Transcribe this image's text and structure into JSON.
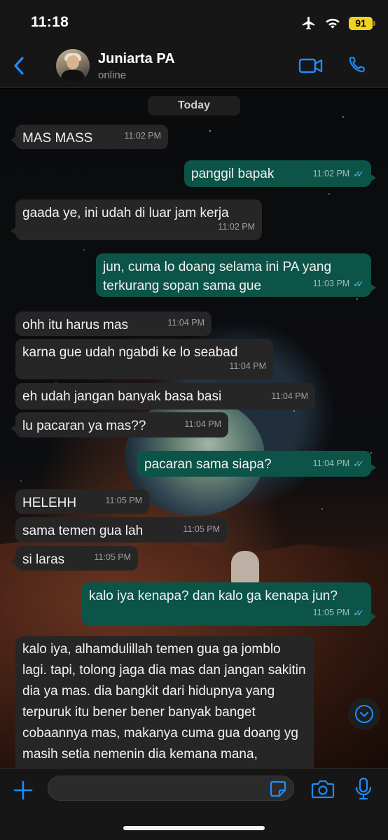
{
  "status_bar": {
    "time": "11:18",
    "battery": "91"
  },
  "header": {
    "contact_name": "Juniarta PA",
    "contact_status": "online",
    "back_icon": "chevron-left-icon",
    "video_icon": "video-camera-icon",
    "call_icon": "phone-icon"
  },
  "chat": {
    "date_label": "Today",
    "messages": [
      {
        "direction": "in",
        "text": "MAS MASS",
        "time": "11:02 PM"
      },
      {
        "direction": "out",
        "text": "panggil bapak",
        "time": "11:02 PM",
        "read": true
      },
      {
        "direction": "in",
        "text": "gaada ye, ini udah di luar jam kerja",
        "time": "11:02 PM"
      },
      {
        "direction": "out",
        "text": "jun, cuma lo doang selama ini PA yang terkurang sopan sama gue",
        "time": "11:03 PM",
        "read": true
      },
      {
        "direction": "in",
        "text": "ohh itu harus mas",
        "time": "11:04 PM"
      },
      {
        "direction": "in",
        "text": "karna gue udah ngabdi ke lo seabad",
        "time": "11:04 PM"
      },
      {
        "direction": "in",
        "text": "eh udah jangan banyak basa basi",
        "time": "11:04 PM"
      },
      {
        "direction": "in",
        "text": "lu pacaran ya mas??",
        "time": "11:04 PM"
      },
      {
        "direction": "out",
        "text": "pacaran sama siapa?",
        "time": "11:04 PM",
        "read": true
      },
      {
        "direction": "in",
        "text": "HELEHH",
        "time": "11:05 PM"
      },
      {
        "direction": "in",
        "text": "sama temen gua lah",
        "time": "11:05 PM"
      },
      {
        "direction": "in",
        "text": "si laras",
        "time": "11:05 PM"
      },
      {
        "direction": "out",
        "text": "kalo iya kenapa? dan kalo ga kenapa jun?",
        "time": "11:05 PM",
        "read": true
      },
      {
        "direction": "in",
        "text": "kalo iya, alhamdulillah temen gua ga jomblo lagi. tapi, tolong jaga dia mas dan jangan sakitin dia ya mas. dia bangkit dari hidupnya yang terpuruk itu bener bener banyak banget cobaannya mas, makanya cuma gua doang yg masih setia nemenin dia kemana mana, makanya gua makasih",
        "time": ""
      }
    ]
  },
  "input_bar": {
    "placeholder": "",
    "plus_icon": "plus-icon",
    "sticker_icon": "sticker-icon",
    "camera_icon": "camera-icon",
    "mic_icon": "microphone-icon"
  },
  "scroll_icon": "chevron-down-circle-icon",
  "colors": {
    "accent": "#1f8cff",
    "outgoing_bubble": "#0d5448",
    "incoming_bubble": "#262626",
    "read_ticks": "#53bdeb",
    "battery": "#f1d21f"
  }
}
